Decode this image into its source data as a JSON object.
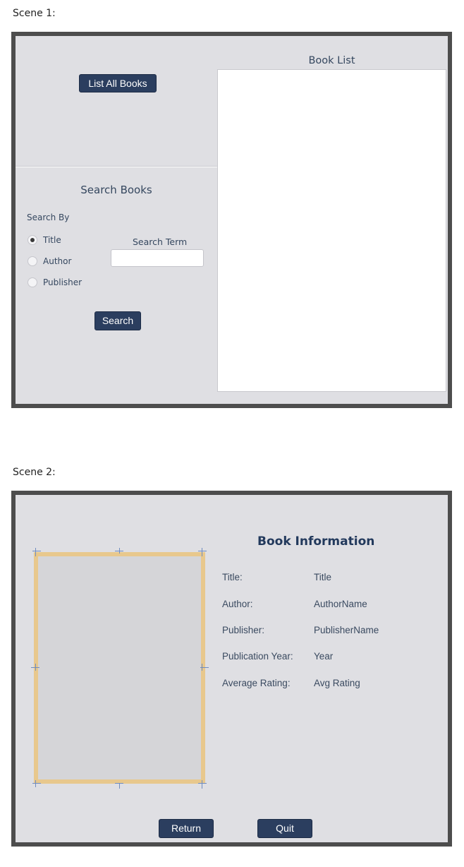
{
  "scene1": {
    "caption": "Scene 1:",
    "list_all_button": "List All Books",
    "book_list_title": "Book List",
    "search_title": "Search Books",
    "search_by_label": "Search By",
    "radio_options": [
      {
        "label": "Title",
        "selected": true
      },
      {
        "label": "Author",
        "selected": false
      },
      {
        "label": "Publisher",
        "selected": false
      }
    ],
    "search_term_label": "Search Term",
    "search_term_value": "",
    "search_button": "Search"
  },
  "scene2": {
    "caption": "Scene 2:",
    "title": "Book Information",
    "fields": [
      {
        "label": "Title:",
        "value": "Title"
      },
      {
        "label": "Author:",
        "value": "AuthorName"
      },
      {
        "label": "Publisher:",
        "value": "PublisherName"
      },
      {
        "label": "Publication Year:",
        "value": "Year"
      },
      {
        "label": "Average Rating:",
        "value": "Avg Rating"
      }
    ],
    "return_button": "Return",
    "quit_button": "Quit"
  },
  "colors": {
    "button": "#2b3e5f",
    "panel_bg": "#dfdfe3",
    "frame_border": "#4d4d4d",
    "image_border": "#e8c88d"
  }
}
